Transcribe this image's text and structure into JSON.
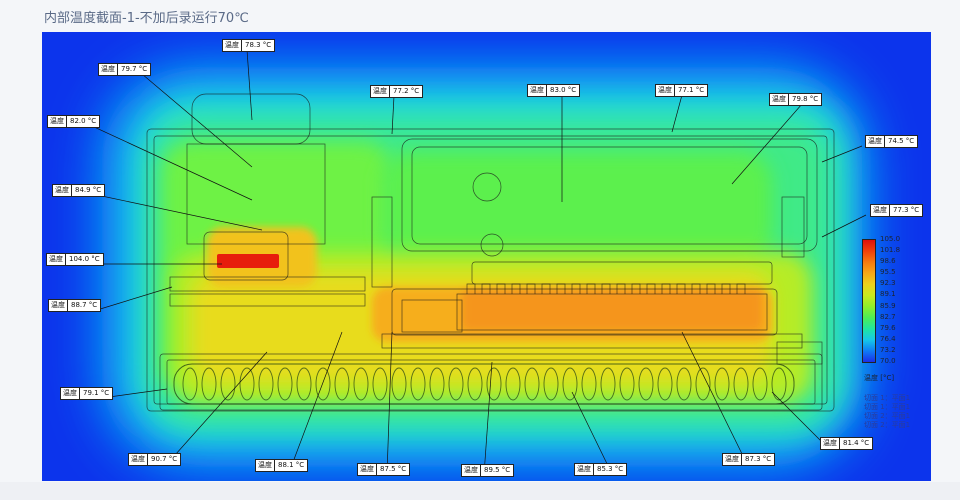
{
  "page": {
    "title": "内部温度截面-1-不加后录运行70℃"
  },
  "labels": {
    "probe_key": "温度",
    "probes": [
      {
        "id": "p1",
        "value": "78.3 °C"
      },
      {
        "id": "p2",
        "value": "79.7 °C"
      },
      {
        "id": "p3",
        "value": "77.2 °C"
      },
      {
        "id": "p4",
        "value": "83.0 °C"
      },
      {
        "id": "p5",
        "value": "77.1 °C"
      },
      {
        "id": "p6",
        "value": "79.8 °C"
      },
      {
        "id": "p7",
        "value": "82.0 °C"
      },
      {
        "id": "p8",
        "value": "74.5 °C"
      },
      {
        "id": "p9",
        "value": "84.9 °C"
      },
      {
        "id": "p10",
        "value": "77.3 °C"
      },
      {
        "id": "p11",
        "value": "104.0 °C"
      },
      {
        "id": "p12",
        "value": "88.7 °C"
      },
      {
        "id": "p13",
        "value": "79.1 °C"
      },
      {
        "id": "p14",
        "value": "81.4 °C"
      },
      {
        "id": "p15",
        "value": "90.7 °C"
      },
      {
        "id": "p16",
        "value": "88.1 °C"
      },
      {
        "id": "p17",
        "value": "87.5 °C"
      },
      {
        "id": "p18",
        "value": "89.5 °C"
      },
      {
        "id": "p19",
        "value": "85.3 °C"
      },
      {
        "id": "p20",
        "value": "87.3 °C"
      }
    ]
  },
  "legend": {
    "unit_label": "温度 [°C]",
    "ticks": [
      "105.0",
      "101.8",
      "98.6",
      "95.5",
      "92.3",
      "89.1",
      "85.9",
      "82.7",
      "79.6",
      "76.4",
      "73.2",
      "70.0"
    ],
    "notes": [
      "切面 1：平面1",
      "切面 1：平面1",
      "切面 2：平面1",
      "切面 2：平面1"
    ],
    "colors": [
      "#e0100a",
      "#f0400a",
      "#f57a10",
      "#f8a818",
      "#ecd21c",
      "#c8ea1e",
      "#8ef02a",
      "#4cee56",
      "#20e6a0",
      "#16c8e8",
      "#0f7cf5",
      "#1a2ee8"
    ]
  }
}
